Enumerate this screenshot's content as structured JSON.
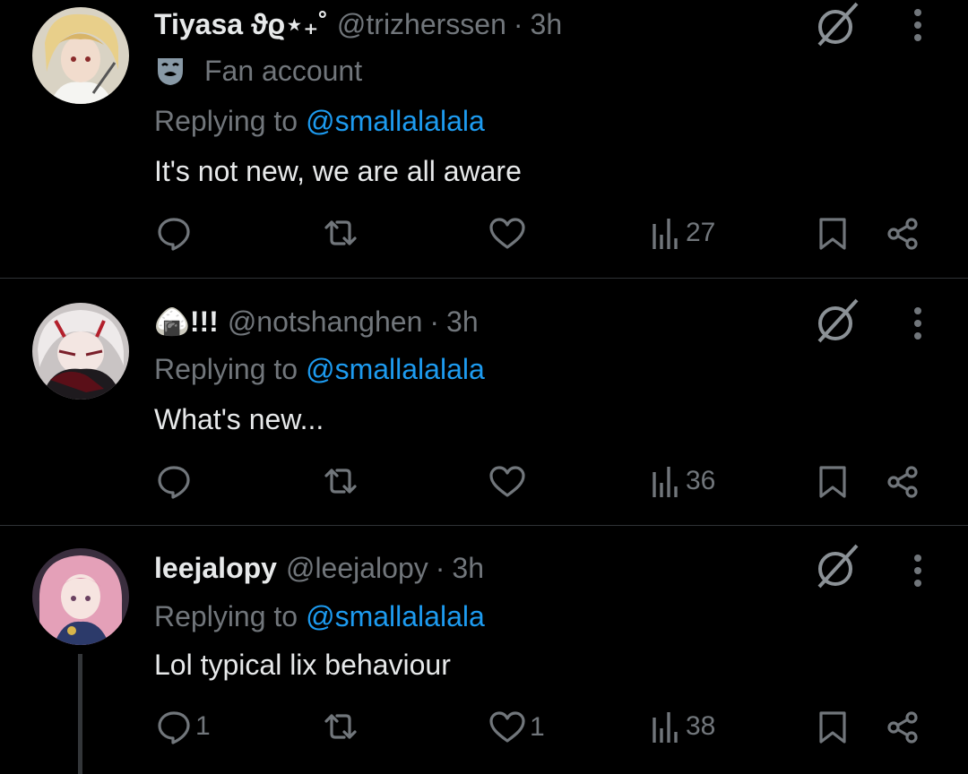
{
  "tweets": [
    {
      "name": "Tiyasa ϑϱ⋆₊˚",
      "handle": "@trizherssen",
      "dot": "·",
      "time": "3h",
      "account_label": "Fan account",
      "replying_prefix": "Replying to",
      "replying_to": "@smallalalala",
      "text": "It's not new, we are all aware",
      "reply_count": "",
      "repost_count": "",
      "like_count": "",
      "views": "27"
    },
    {
      "name": "🍙!!!",
      "handle": "@notshanghen",
      "dot": "·",
      "time": "3h",
      "replying_prefix": "Replying to",
      "replying_to": "@smallalalala",
      "text": "What's new...",
      "reply_count": "",
      "repost_count": "",
      "like_count": "",
      "views": "36"
    },
    {
      "name": "leejalopy",
      "handle": "@leejalopy",
      "dot": "·",
      "time": "3h",
      "replying_prefix": "Replying to",
      "replying_to": "@smallalalala",
      "text": "Lol typical lix behaviour",
      "reply_count": "1",
      "repost_count": "",
      "like_count": "1",
      "views": "38"
    }
  ],
  "colors": {
    "background": "#000000",
    "text": "#e7e9ea",
    "muted": "#71767b",
    "link": "#1d9bf0",
    "divider": "#2f3336"
  },
  "icons": [
    "reply-icon",
    "repost-icon",
    "like-icon",
    "views-icon",
    "bookmark-icon",
    "share-icon",
    "grok-icon",
    "more-icon",
    "theater-masks-icon"
  ]
}
